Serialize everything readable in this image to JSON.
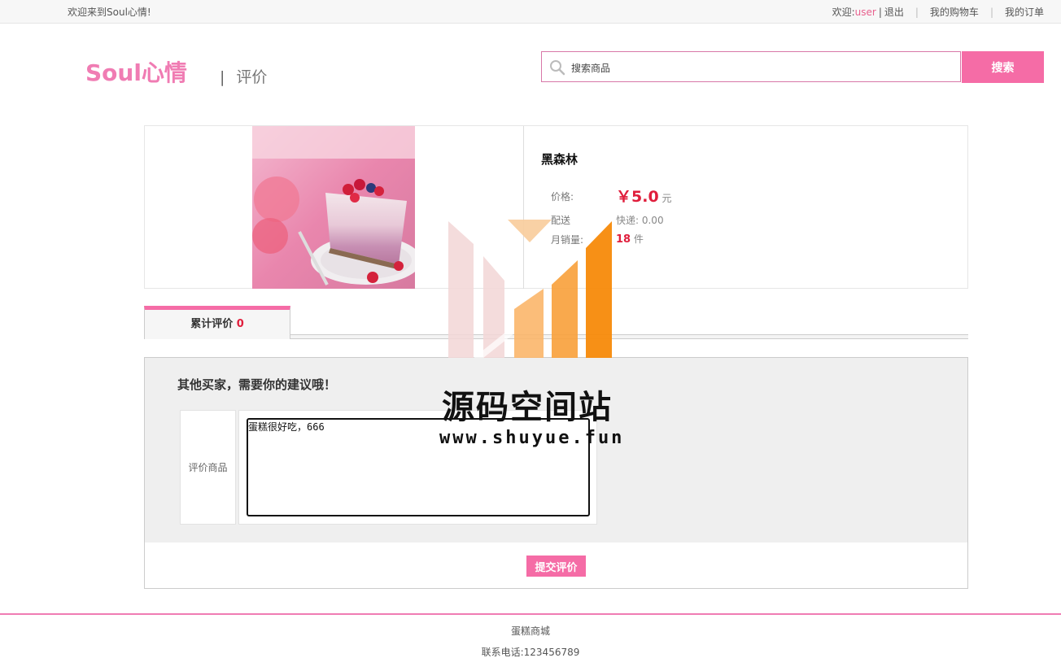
{
  "topbar": {
    "welcome": "欢迎来到Soul心情!",
    "greeting": "欢迎:",
    "username": "user",
    "divider": "|",
    "logout": "退出",
    "cart": "我的购物车",
    "orders": "我的订单"
  },
  "header": {
    "logo": "Soul心情",
    "page_title": "评价",
    "bar": "|",
    "search_placeholder": "搜索商品",
    "search_button": "搜索"
  },
  "product": {
    "name": "黑森林",
    "price_label": "价格:",
    "price_value": "￥5.0",
    "price_unit": "元",
    "shipping_label": "配送",
    "shipping_value": "快递: 0.00",
    "sales_label": "月销量:",
    "sales_value": "18",
    "sales_unit": "件"
  },
  "tab": {
    "label": "累计评价",
    "count": "0"
  },
  "review": {
    "heading": "其他买家，需要你的建议哦！",
    "row_label": "评价商品",
    "text": "蛋糕很好吃，666",
    "submit": "提交评价"
  },
  "watermark": {
    "title": "源码空间站",
    "url": "www.shuyue.fun"
  },
  "footer": {
    "shop": "蛋糕商城",
    "phone": "联系电话:123456789"
  },
  "colors": {
    "brand_pink": "#f56ca6",
    "price_red": "#e01e3c"
  }
}
